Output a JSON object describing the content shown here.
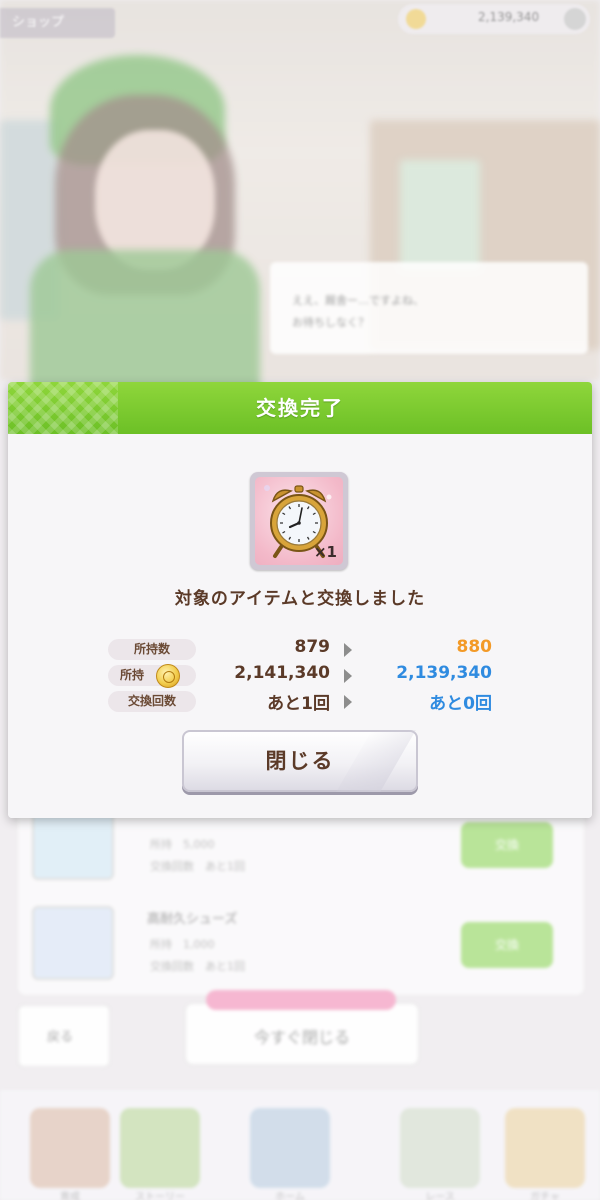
{
  "background": {
    "top_tab": "ショップ",
    "money": "2,139,340",
    "speech_line1": "ええ、厩舎ー…ですよね、",
    "speech_line2": "お待ちしなく？",
    "list_items": [
      {
        "name": "",
        "row1": "所持",
        "row1_value": "5,000",
        "row2": "交換回数",
        "row2_value": "あと1回",
        "button": "交換"
      },
      {
        "name": "高耐久シューズ",
        "row1": "所持",
        "row1_value": "1,000",
        "row2": "交換回数",
        "row2_value": "あと1回",
        "button": "交換"
      }
    ],
    "back_label": "戻る",
    "close_now_label": "今すぐ閉じる",
    "nav_labels": [
      "育成",
      "ストーリー",
      "ホーム",
      "レース",
      "ガチャ"
    ]
  },
  "modal": {
    "title": "交換完了",
    "item": {
      "icon": "alarm-clock-icon",
      "quantity": "×1"
    },
    "message": "対象のアイテムと交換しました",
    "stats": [
      {
        "label": "所持数",
        "from": "879",
        "to": "880",
        "to_color": "#f39a27"
      },
      {
        "label": "所持",
        "icon": "coin-icon",
        "from": "2,141,340",
        "to": "2,139,340",
        "to_color": "#2f8be0"
      },
      {
        "label": "交換回数",
        "from": "あと1回",
        "to": "あと0回",
        "to_color": "#2f8be0"
      }
    ],
    "close_button": "閉じる"
  },
  "colors": {
    "header_green": "#7ccb30",
    "text_brown": "#5b3a28",
    "accent_orange": "#f39a27",
    "accent_blue": "#2f8be0"
  }
}
